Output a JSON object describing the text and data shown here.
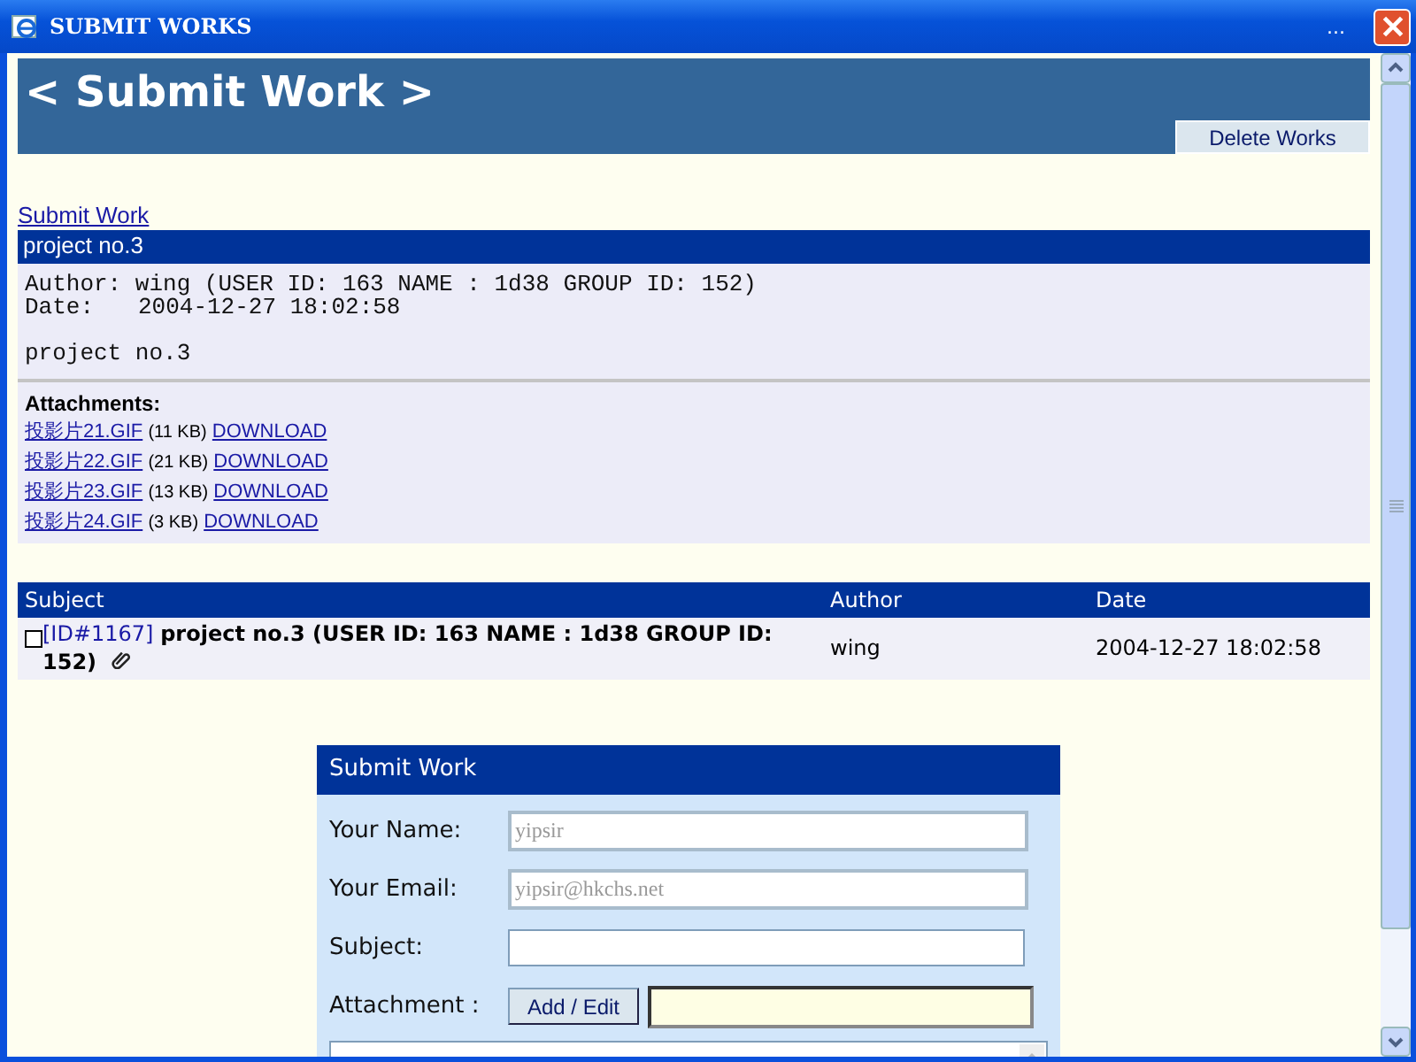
{
  "window": {
    "title": "SUBMIT WORKS",
    "title_extra": "..."
  },
  "banner": {
    "title": "< Submit Work >",
    "button": "Delete Works"
  },
  "breadcrumb": "Submit Work",
  "post": {
    "title": "project no.3",
    "author_label": "Author:",
    "author": "wing (USER ID: 163 NAME : 1d38 GROUP ID: 152)",
    "date_label": "Date:",
    "date": "2004-12-27 18:02:58",
    "body": "project no.3",
    "attachments_label": "Attachments:",
    "attachments": [
      {
        "name": "投影片21.GIF",
        "size": "(11 KB)",
        "link": "DOWNLOAD"
      },
      {
        "name": "投影片22.GIF",
        "size": "(21 KB)",
        "link": "DOWNLOAD"
      },
      {
        "name": "投影片23.GIF",
        "size": "(13 KB)",
        "link": "DOWNLOAD"
      },
      {
        "name": "投影片24.GIF",
        "size": "(3 KB)",
        "link": "DOWNLOAD"
      }
    ]
  },
  "table": {
    "columns": [
      "Subject",
      "Author",
      "Date"
    ],
    "rows": [
      {
        "checked": false,
        "id": "[ID#1167]",
        "subject": "project no.3 (USER ID: 163 NAME : 1d38 GROUP ID: 152)",
        "has_attachment": true,
        "author": "wing",
        "date": "2004-12-27 18:02:58"
      }
    ]
  },
  "form": {
    "title": "Submit Work",
    "fields": [
      {
        "label": "Your Name:",
        "value": "yipsir",
        "disabled": true
      },
      {
        "label": "Your Email:",
        "value": "yipsir@hkchs.net",
        "disabled": true
      },
      {
        "label": "Subject:",
        "disabled": false
      }
    ],
    "attachment_label": "Attachment :",
    "attachment_button": "Add / Edit"
  }
}
